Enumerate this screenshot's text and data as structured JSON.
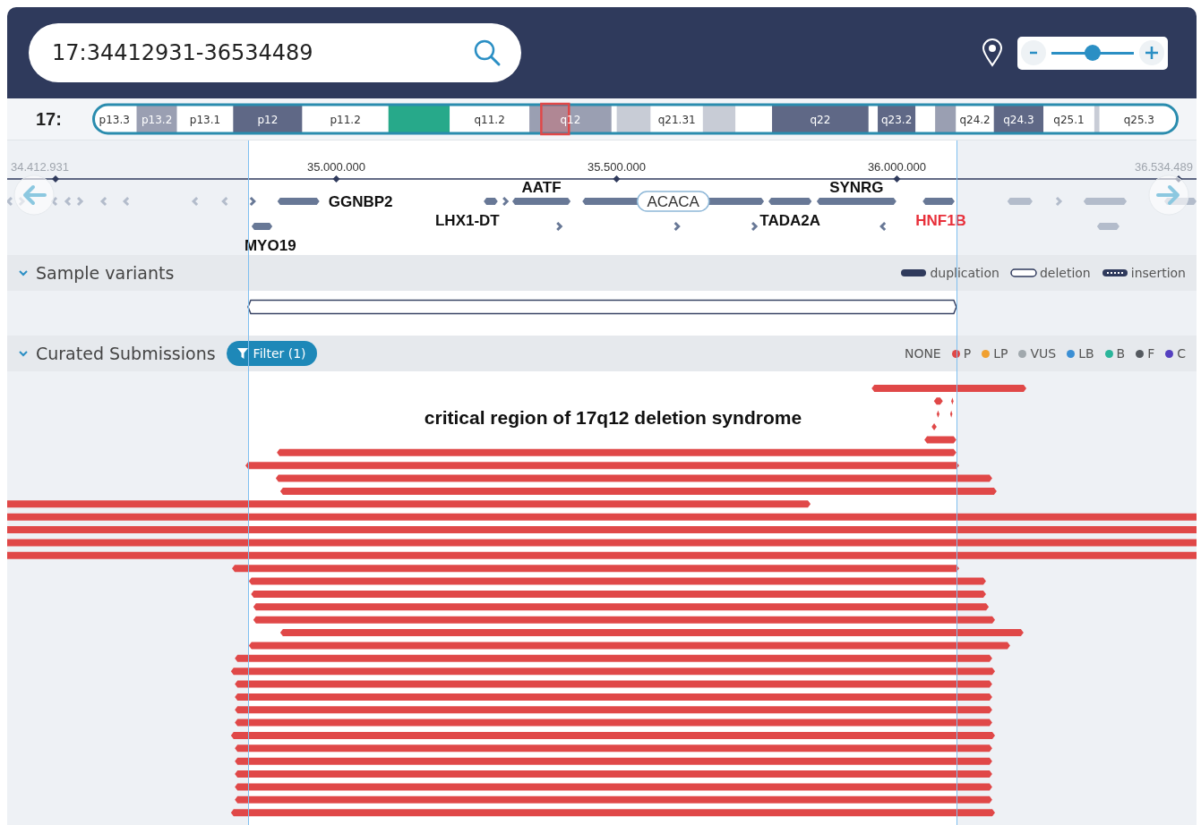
{
  "search": {
    "value": "17:34412931-36534489"
  },
  "zoom": {
    "level": 0.5
  },
  "chromosome": {
    "label": "17:",
    "bands": [
      {
        "label": "p13.3",
        "kind": "gneg"
      },
      {
        "label": "p13.2",
        "kind": "gpos50"
      },
      {
        "label": "p13.1",
        "kind": "gneg"
      },
      {
        "label": "p12",
        "kind": "gpos75"
      },
      {
        "label": "p11.2",
        "kind": "gneg"
      },
      {
        "kind": "acen"
      },
      {
        "label": "q11.2",
        "kind": "gneg"
      },
      {
        "label": "q12",
        "kind": "gpos50"
      },
      {
        "kind": "gneg"
      },
      {
        "kind": "gpos25"
      },
      {
        "label": "q21.31",
        "kind": "gneg"
      },
      {
        "kind": "gpos25"
      },
      {
        "kind": "gneg"
      },
      {
        "label": "q22",
        "kind": "gpos75"
      },
      {
        "kind": "gneg"
      },
      {
        "label": "q23.2",
        "kind": "gpos75"
      },
      {
        "kind": "gneg"
      },
      {
        "kind": "gpos50"
      },
      {
        "label": "q24.2",
        "kind": "gneg"
      },
      {
        "label": "q24.3",
        "kind": "gpos75"
      },
      {
        "label": "q25.1",
        "kind": "gneg"
      },
      {
        "kind": "gpos25"
      },
      {
        "label": "q25.3",
        "kind": "gneg"
      }
    ]
  },
  "axis": {
    "start_label": "34.412.931",
    "end_label": "36.534.489",
    "ticks": [
      "35.000.000",
      "35.500.000",
      "36.000.000"
    ]
  },
  "genes": [
    {
      "name": "MYO19",
      "highlighted": false
    },
    {
      "name": "GGNBP2",
      "highlighted": false
    },
    {
      "name": "LHX1-DT",
      "highlighted": false
    },
    {
      "name": "AATF",
      "highlighted": false
    },
    {
      "name": "ACACA",
      "highlighted": false
    },
    {
      "name": "TADA2A",
      "highlighted": false
    },
    {
      "name": "SYNRG",
      "highlighted": false
    },
    {
      "name": "HNF1B",
      "highlighted": true
    }
  ],
  "sample_variants": {
    "title": "Sample variants",
    "expanded": true,
    "legend": [
      {
        "kind": "filled",
        "label": "duplication"
      },
      {
        "kind": "outline",
        "label": "deletion"
      },
      {
        "kind": "dotted",
        "label": "insertion"
      }
    ],
    "variants": [
      {
        "kind": "outline"
      }
    ]
  },
  "curated": {
    "title": "Curated Submissions",
    "expanded": true,
    "filter_label": "Filter (1)",
    "legend": [
      {
        "label": "NONE"
      },
      {
        "label": "P",
        "color": "#e04848"
      },
      {
        "label": "LP",
        "color": "#f0a030"
      },
      {
        "label": "VUS",
        "color": "#a0a8ad"
      },
      {
        "label": "LB",
        "color": "#3b8fd4"
      },
      {
        "label": "B",
        "color": "#2ab59a"
      },
      {
        "label": "F",
        "color": "#555a60"
      },
      {
        "label": "C",
        "color": "#5540c0"
      }
    ],
    "annotation": "critical region of 17q12 deletion syndrome",
    "rows": [
      {
        "variants": [
          {
            "color": "#e04848"
          }
        ]
      },
      {
        "variants": [
          {
            "color": "#e04848"
          },
          {
            "color": "#e04848"
          }
        ]
      },
      {
        "variants": [
          {
            "color": "#e04848"
          },
          {
            "color": "#e04848"
          }
        ]
      },
      {
        "variants": [
          {
            "color": "#e04848"
          }
        ]
      },
      {
        "variants": [
          {
            "color": "#e04848"
          }
        ]
      },
      {
        "variants": [
          {
            "color": "#e04848"
          }
        ]
      },
      {
        "variants": [
          {
            "color": "#e04848"
          }
        ]
      },
      {
        "variants": [
          {
            "color": "#e04848"
          }
        ]
      },
      {
        "variants": [
          {
            "color": "#e04848"
          }
        ]
      },
      {
        "variants": [
          {
            "color": "#e04848"
          }
        ]
      },
      {
        "variants": [
          {
            "color": "#e04848"
          }
        ]
      },
      {
        "variants": [
          {
            "color": "#e04848"
          }
        ]
      },
      {
        "variants": [
          {
            "color": "#e04848"
          }
        ]
      },
      {
        "variants": [
          {
            "color": "#e04848"
          }
        ]
      },
      {
        "variants": [
          {
            "color": "#e04848"
          }
        ]
      },
      {
        "variants": [
          {
            "color": "#e04848"
          }
        ]
      },
      {
        "variants": [
          {
            "color": "#e04848"
          }
        ]
      },
      {
        "variants": [
          {
            "color": "#e04848"
          }
        ]
      },
      {
        "variants": [
          {
            "color": "#e04848"
          }
        ]
      },
      {
        "variants": [
          {
            "color": "#e04848"
          }
        ]
      },
      {
        "variants": [
          {
            "color": "#e04848"
          }
        ]
      },
      {
        "variants": [
          {
            "color": "#e04848"
          }
        ]
      },
      {
        "variants": [
          {
            "color": "#e04848"
          }
        ]
      },
      {
        "variants": [
          {
            "color": "#e04848"
          }
        ]
      },
      {
        "variants": [
          {
            "color": "#e04848"
          }
        ]
      },
      {
        "variants": [
          {
            "color": "#e04848"
          }
        ]
      },
      {
        "variants": [
          {
            "color": "#e04848"
          }
        ]
      },
      {
        "variants": [
          {
            "color": "#e04848"
          }
        ]
      },
      {
        "variants": [
          {
            "color": "#e04848"
          }
        ]
      },
      {
        "variants": [
          {
            "color": "#e04848"
          }
        ]
      },
      {
        "variants": [
          {
            "color": "#e04848"
          }
        ]
      },
      {
        "variants": [
          {
            "color": "#e04848"
          }
        ]
      },
      {
        "variants": [
          {
            "color": "#e04848"
          }
        ]
      },
      {
        "variants": [
          {
            "color": "#e04848"
          }
        ]
      }
    ]
  }
}
